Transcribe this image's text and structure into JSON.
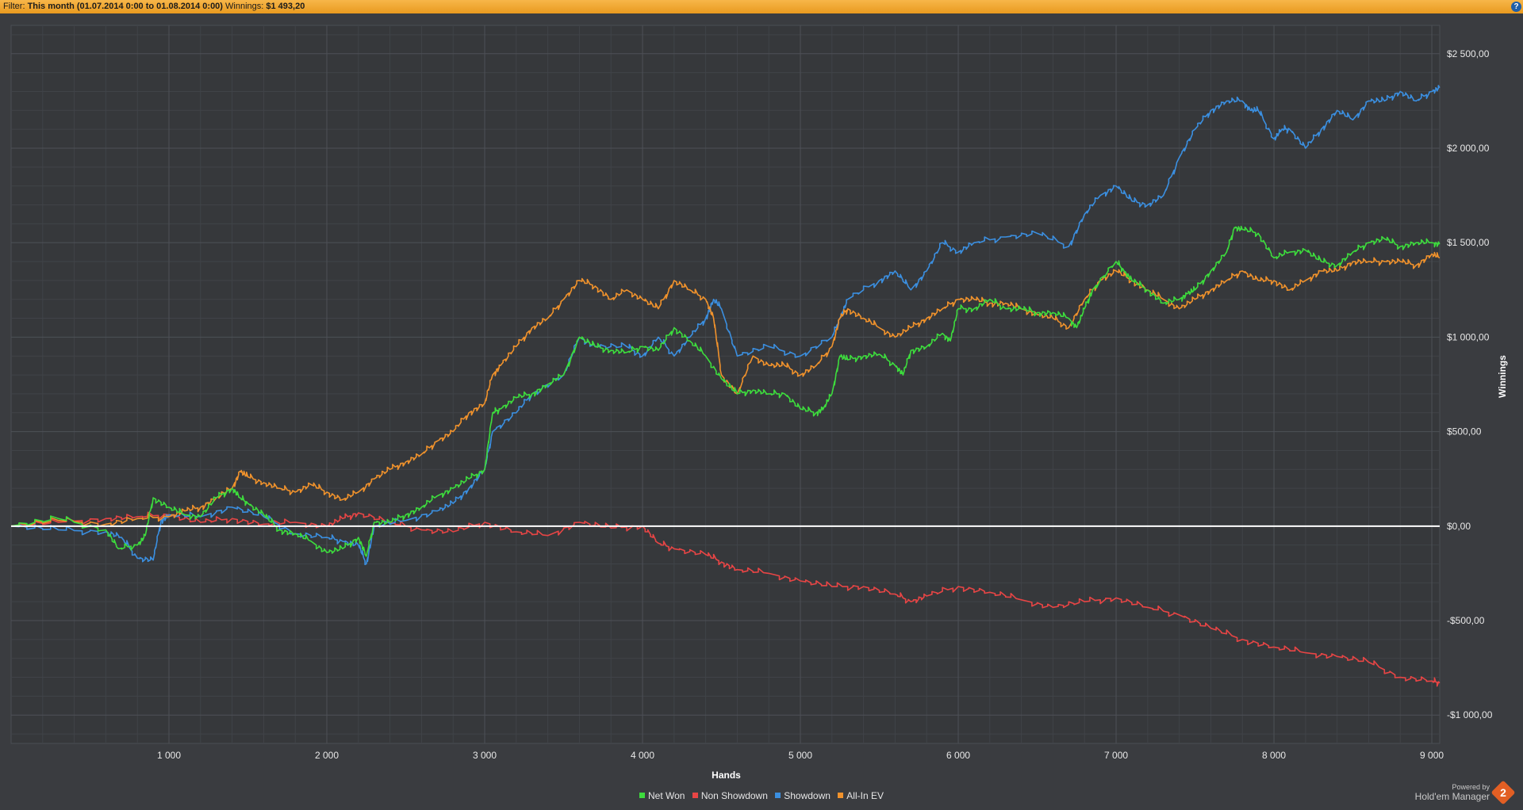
{
  "filter": {
    "label": "Filter:",
    "period": "This month (01.07.2014 0:00 to 01.08.2014 0:00)",
    "winnings_label": "Winnings:",
    "winnings_value": "$1 493,20"
  },
  "help_icon": "help-icon",
  "branding": {
    "powered_by": "Powered by",
    "product": "Hold'em Manager",
    "logo_text": "2"
  },
  "colors": {
    "background": "#3a3c40",
    "plot_bg": "#36383b",
    "grid": "#4b4e53",
    "zero_line": "#ffffff"
  },
  "chart_data": {
    "type": "line",
    "xlabel": "Hands",
    "ylabel": "Winnings",
    "xlim": [
      0,
      9050
    ],
    "ylim": [
      -1150,
      2650
    ],
    "x_ticks": [
      {
        "value": 1000,
        "label": "1 000"
      },
      {
        "value": 2000,
        "label": "2 000"
      },
      {
        "value": 3000,
        "label": "3 000"
      },
      {
        "value": 4000,
        "label": "4 000"
      },
      {
        "value": 5000,
        "label": "5 000"
      },
      {
        "value": 6000,
        "label": "6 000"
      },
      {
        "value": 7000,
        "label": "7 000"
      },
      {
        "value": 8000,
        "label": "8 000"
      },
      {
        "value": 9000,
        "label": "9 000"
      }
    ],
    "y_ticks": [
      {
        "value": 2500,
        "label": "$2 500,00"
      },
      {
        "value": 2000,
        "label": "$2 000,00"
      },
      {
        "value": 1500,
        "label": "$1 500,00"
      },
      {
        "value": 1000,
        "label": "$1 000,00"
      },
      {
        "value": 500,
        "label": "$500,00"
      },
      {
        "value": 0,
        "label": "$0,00"
      },
      {
        "value": -500,
        "label": "-$500,00"
      },
      {
        "value": -1000,
        "label": "-$1 000,00"
      }
    ],
    "grid": true,
    "legend_position": "bottom-center",
    "series": [
      {
        "name": "Net Won",
        "color": "#3ddc3d",
        "x": [
          0,
          300,
          600,
          680,
          800,
          850,
          900,
          1000,
          1100,
          1200,
          1300,
          1400,
          1450,
          1500,
          1600,
          1700,
          1800,
          1900,
          2000,
          2100,
          2200,
          2250,
          2300,
          2400,
          2500,
          2600,
          2700,
          2800,
          2900,
          3000,
          3050,
          3100,
          3200,
          3300,
          3400,
          3500,
          3600,
          3700,
          3800,
          3900,
          4000,
          4100,
          4200,
          4300,
          4400,
          4500,
          4600,
          4700,
          4800,
          4900,
          5000,
          5100,
          5150,
          5200,
          5250,
          5300,
          5400,
          5500,
          5600,
          5650,
          5700,
          5800,
          5900,
          5950,
          6000,
          6100,
          6200,
          6300,
          6400,
          6500,
          6600,
          6700,
          6750,
          6800,
          6850,
          7000,
          7050,
          7100,
          7200,
          7300,
          7400,
          7450,
          7500,
          7600,
          7700,
          7750,
          7800,
          7900,
          8000,
          8100,
          8200,
          8300,
          8400,
          8500,
          8600,
          8700,
          8800,
          8900,
          9000,
          9050
        ],
        "y": [
          0,
          40,
          -20,
          -120,
          -100,
          -50,
          150,
          100,
          60,
          50,
          150,
          200,
          150,
          120,
          60,
          -20,
          -40,
          -80,
          -140,
          -120,
          -60,
          -160,
          20,
          20,
          60,
          100,
          160,
          200,
          250,
          300,
          600,
          620,
          680,
          700,
          750,
          800,
          1000,
          950,
          930,
          920,
          950,
          930,
          1050,
          980,
          900,
          780,
          700,
          720,
          700,
          700,
          620,
          600,
          630,
          700,
          900,
          880,
          900,
          910,
          850,
          800,
          930,
          950,
          1020,
          980,
          1150,
          1150,
          1200,
          1150,
          1150,
          1130,
          1130,
          1100,
          1050,
          1150,
          1250,
          1400,
          1350,
          1300,
          1250,
          1180,
          1200,
          1230,
          1250,
          1350,
          1450,
          1580,
          1570,
          1550,
          1420,
          1450,
          1460,
          1400,
          1380,
          1450,
          1500,
          1520,
          1480,
          1500,
          1500,
          1493
        ]
      },
      {
        "name": "Non Showdown",
        "color": "#e84545",
        "x": [
          0,
          300,
          600,
          800,
          1000,
          1200,
          1400,
          1600,
          1800,
          2000,
          2100,
          2200,
          2400,
          2600,
          2800,
          3000,
          3200,
          3400,
          3600,
          3800,
          4000,
          4100,
          4200,
          4400,
          4500,
          4600,
          4800,
          5000,
          5200,
          5400,
          5600,
          5700,
          5800,
          6000,
          6200,
          6400,
          6600,
          6800,
          7000,
          7200,
          7400,
          7600,
          7800,
          8000,
          8200,
          8400,
          8600,
          8800,
          9000,
          9050
        ],
        "y": [
          0,
          20,
          40,
          50,
          60,
          20,
          40,
          10,
          20,
          0,
          40,
          70,
          20,
          -20,
          -30,
          20,
          -30,
          -50,
          20,
          -10,
          0,
          -90,
          -120,
          -150,
          -190,
          -230,
          -250,
          -290,
          -320,
          -320,
          -360,
          -400,
          -370,
          -320,
          -350,
          -390,
          -430,
          -400,
          -380,
          -430,
          -470,
          -540,
          -600,
          -640,
          -670,
          -690,
          -720,
          -800,
          -820,
          -830
        ]
      },
      {
        "name": "Showdown",
        "color": "#3b8fe0",
        "x": [
          0,
          300,
          600,
          700,
          800,
          900,
          950,
          1000,
          1200,
          1400,
          1600,
          1800,
          2000,
          2100,
          2200,
          2250,
          2300,
          2500,
          2700,
          2800,
          2900,
          3000,
          3050,
          3200,
          3300,
          3500,
          3600,
          3700,
          3900,
          4000,
          4100,
          4200,
          4300,
          4400,
          4450,
          4500,
          4600,
          4800,
          5000,
          5200,
          5250,
          5300,
          5500,
          5600,
          5700,
          5800,
          5900,
          6000,
          6100,
          6300,
          6500,
          6700,
          6800,
          6900,
          7000,
          7100,
          7200,
          7300,
          7400,
          7500,
          7600,
          7700,
          7800,
          7850,
          7900,
          8000,
          8050,
          8100,
          8200,
          8300,
          8400,
          8500,
          8600,
          8700,
          8800,
          8900,
          9000,
          9050
        ],
        "y": [
          0,
          -20,
          -30,
          -60,
          -170,
          -180,
          30,
          60,
          50,
          100,
          50,
          -40,
          -60,
          -80,
          -100,
          -200,
          0,
          30,
          80,
          120,
          200,
          300,
          500,
          600,
          700,
          800,
          1000,
          950,
          950,
          900,
          1000,
          900,
          1000,
          1100,
          1200,
          1150,
          900,
          950,
          900,
          1000,
          1100,
          1200,
          1300,
          1350,
          1250,
          1350,
          1500,
          1450,
          1500,
          1530,
          1550,
          1480,
          1650,
          1750,
          1800,
          1720,
          1700,
          1750,
          1950,
          2100,
          2200,
          2250,
          2250,
          2200,
          2200,
          2050,
          2100,
          2100,
          2000,
          2100,
          2200,
          2150,
          2250,
          2250,
          2300,
          2250,
          2300,
          2320
        ]
      },
      {
        "name": "All-In EV",
        "color": "#f0922c",
        "x": [
          0,
          300,
          600,
          800,
          1000,
          1100,
          1200,
          1300,
          1400,
          1450,
          1500,
          1600,
          1700,
          1800,
          1900,
          2000,
          2100,
          2200,
          2300,
          2400,
          2500,
          2600,
          2700,
          2800,
          2900,
          3000,
          3050,
          3100,
          3200,
          3300,
          3400,
          3500,
          3600,
          3700,
          3800,
          3900,
          4000,
          4100,
          4200,
          4300,
          4400,
          4450,
          4500,
          4600,
          4700,
          4800,
          4900,
          5000,
          5100,
          5200,
          5250,
          5300,
          5400,
          5500,
          5600,
          5700,
          5800,
          5900,
          6000,
          6100,
          6200,
          6300,
          6400,
          6500,
          6600,
          6700,
          6800,
          6900,
          7000,
          7100,
          7200,
          7300,
          7400,
          7500,
          7600,
          7700,
          7800,
          7900,
          8000,
          8100,
          8200,
          8300,
          8400,
          8500,
          8600,
          8700,
          8800,
          8900,
          9000,
          9050
        ],
        "y": [
          0,
          30,
          10,
          40,
          50,
          80,
          100,
          150,
          200,
          290,
          260,
          230,
          200,
          180,
          220,
          180,
          140,
          180,
          250,
          300,
          340,
          380,
          450,
          500,
          600,
          650,
          800,
          850,
          950,
          1050,
          1100,
          1200,
          1300,
          1270,
          1200,
          1250,
          1200,
          1150,
          1300,
          1250,
          1200,
          1100,
          800,
          700,
          900,
          850,
          850,
          800,
          850,
          950,
          1100,
          1150,
          1100,
          1050,
          1000,
          1050,
          1100,
          1150,
          1200,
          1200,
          1180,
          1180,
          1150,
          1120,
          1100,
          1050,
          1200,
          1300,
          1350,
          1300,
          1250,
          1200,
          1150,
          1200,
          1250,
          1300,
          1350,
          1300,
          1300,
          1250,
          1300,
          1350,
          1350,
          1400,
          1400,
          1400,
          1400,
          1380,
          1440,
          1420
        ]
      }
    ]
  }
}
